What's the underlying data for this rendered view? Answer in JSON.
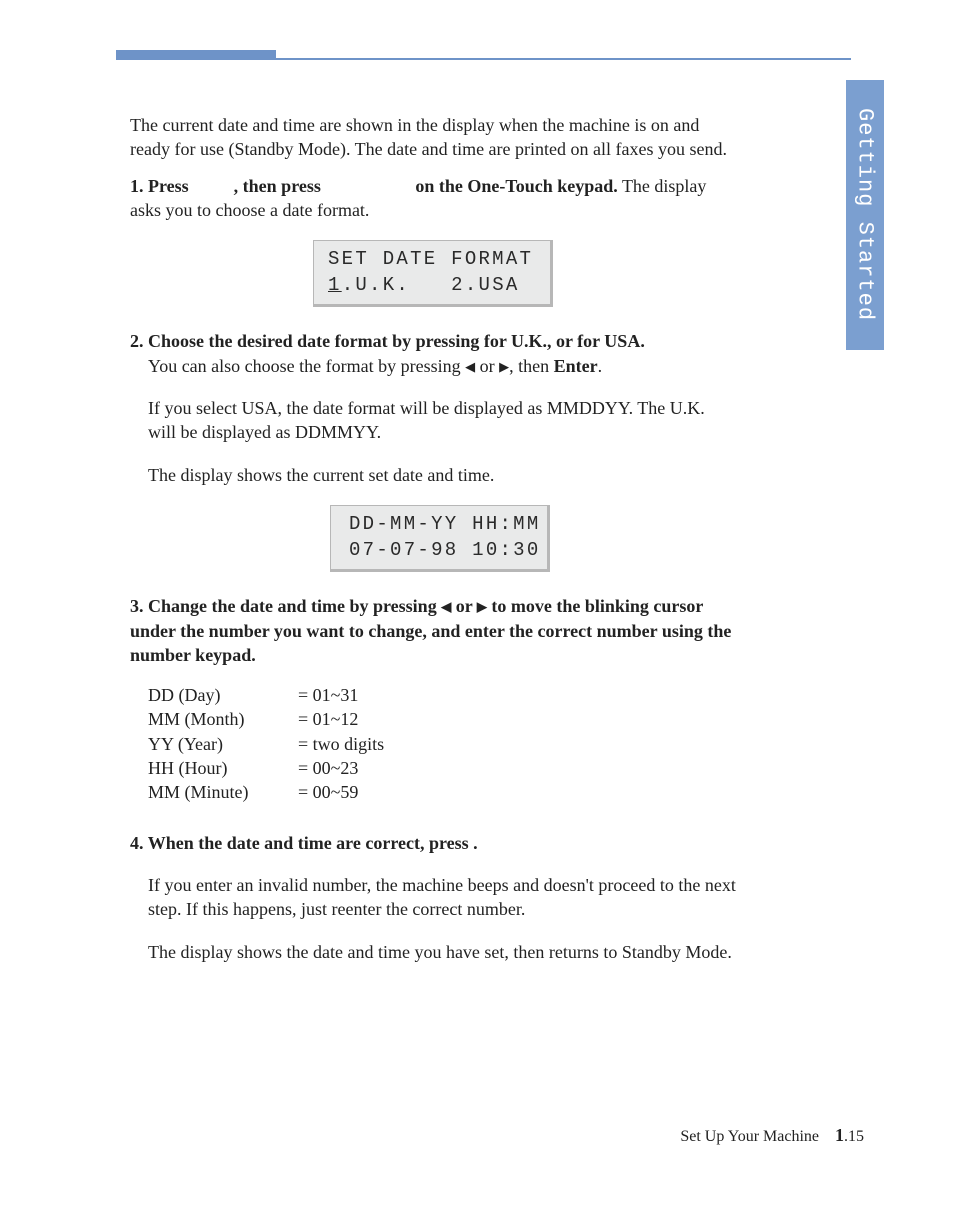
{
  "side_tab": "Getting Started",
  "intro": "The current date and time are shown in the display when the machine is on and ready for use (Standby Mode). The date and time are printed on all faxes you send.",
  "step1": {
    "lead_press": "Press",
    "mid": ", then press",
    "tail": "on the One-Touch keypad.",
    "after": " The display asks you to choose a date format."
  },
  "lcd1": {
    "l1": "SET DATE FORMAT",
    "l2_pre": "1",
    "l2_rest": ".U.K.   2.USA"
  },
  "step2": {
    "bold": "Choose the desired date format by pressing    for U.K., or    for USA.",
    "line2_a": "You can also choose the format by pressing ",
    "line2_b": " or ",
    "line2_c": ", then ",
    "enter": "Enter",
    "line2_d": ".",
    "p1": "If you select USA, the date format will be displayed as MMDDYY. The U.K. will be displayed as DDMMYY.",
    "p2": "The display shows the current set date and time."
  },
  "lcd2": {
    "l1": "DD-MM-YY HH:MM",
    "l2": "07-07-98 10:30"
  },
  "step3": {
    "b1": "Change the date and time by pressing ",
    "b2": " or ",
    "b3": " to move the blinking cursor under the number you want to change, and enter the correct number using the number keypad."
  },
  "ranges": {
    "r1a": "DD (Day)",
    "r1b": "= 01~31",
    "r2a": "MM (Month)",
    "r2b": "= 01~12",
    "r3a": "YY (Year)",
    "r3b": "= two digits",
    "r4a": "HH (Hour)",
    "r4b": "= 00~23",
    "r5a": "MM (Minute)",
    "r5b": "= 00~59"
  },
  "step4": {
    "bold": "When the date and time are correct, press          .",
    "p1": "If you enter an invalid number, the machine beeps and doesn't proceed to the next step. If this happens, just reenter the correct number.",
    "p2": "The display shows the date and time you have set, then returns to Standby Mode."
  },
  "footer": {
    "label": "Set Up Your Machine",
    "chapter": "1",
    "page": ".15"
  }
}
